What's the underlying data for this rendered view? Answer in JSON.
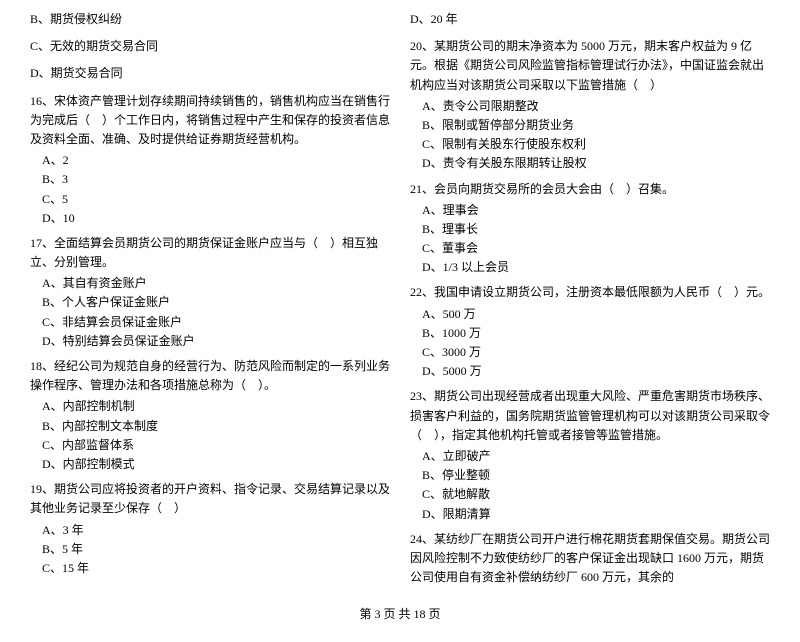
{
  "footer": {
    "text": "第 3 页 共 18 页"
  },
  "left_column": [
    {
      "id": "q_b1",
      "text": "B、期货侵权纠纷",
      "options": []
    },
    {
      "id": "q_c1",
      "text": "C、无效的期货交易合同",
      "options": []
    },
    {
      "id": "q_d1",
      "text": "D、期货交易合同",
      "options": []
    },
    {
      "id": "q16",
      "text": "16、宋体资产管理计划存续期间持续销售的，销售机构应当在销售行为完成后（　）个工作日内，将销售过程中产生和保存的投资者信息及资料全面、准确、及时提供给证券期货经营机构。",
      "options": [
        "A、2",
        "B、3",
        "C、5",
        "D、10"
      ]
    },
    {
      "id": "q17",
      "text": "17、全面结算会员期货公司的期货保证金账户应当与（　）相互独立、分别管理。",
      "options": [
        "A、其自有资金账户",
        "B、个人客户保证金账户",
        "C、非结算会员保证金账户",
        "D、特别结算会员保证金账户"
      ]
    },
    {
      "id": "q18",
      "text": "18、经纪公司为规范自身的经营行为、防范风险而制定的一系列业务操作程序、管理办法和各项措施总称为（　）。",
      "options": [
        "A、内部控制机制",
        "B、内部控制文本制度",
        "C、内部监督体系",
        "D、内部控制模式"
      ]
    },
    {
      "id": "q19",
      "text": "19、期货公司应将投资者的开户资料、指令记录、交易结算记录以及其他业务记录至少保存（　）",
      "options": [
        "A、3 年",
        "B、5 年",
        "C、15 年"
      ]
    }
  ],
  "right_column": [
    {
      "id": "q_d_right",
      "text": "D、20 年",
      "options": []
    },
    {
      "id": "q20",
      "text": "20、某期货公司的期末净资本为 5000 万元，期末客户权益为 9 亿元。根据《期货公司风险监管指标管理试行办法》，中国证监会就出机构应当对该期货公司采取以下监管措施（　）",
      "options": [
        "A、责令公司限期整改",
        "B、限制或暂停部分期货业务",
        "C、限制有关股东行使股东权利",
        "D、责令有关股东限期转让股权"
      ]
    },
    {
      "id": "q21",
      "text": "21、会员向期货交易所的会员大会由（　）召集。",
      "options": [
        "A、理事会",
        "B、理事长",
        "C、董事会",
        "D、1/3 以上会员"
      ]
    },
    {
      "id": "q22",
      "text": "22、我国申请设立期货公司，注册资本最低限额为人民币（　）元。",
      "options": [
        "A、500 万",
        "B、1000 万",
        "C、3000 万",
        "D、5000 万"
      ]
    },
    {
      "id": "q23",
      "text": "23、期货公司出现经营成者出现重大风险、严重危害期货市场秩序、损害客户利益的，国务院期货监管管理机构可以对该期货公司采取令（　），指定其他机构托管或者接管等监管措施。",
      "options": [
        "A、立即破产",
        "B、停业整顿",
        "C、就地解散",
        "D、限期清算"
      ]
    },
    {
      "id": "q24",
      "text": "24、某纺纱厂在期货公司开户进行棉花期货套期保值交易。期货公司因风险控制不力致使纺纱厂的客户保证金出现缺口 1600 万元，期货公司使用自有资金补偿纳纺纱厂 600 万元，其余的",
      "options": []
    }
  ]
}
